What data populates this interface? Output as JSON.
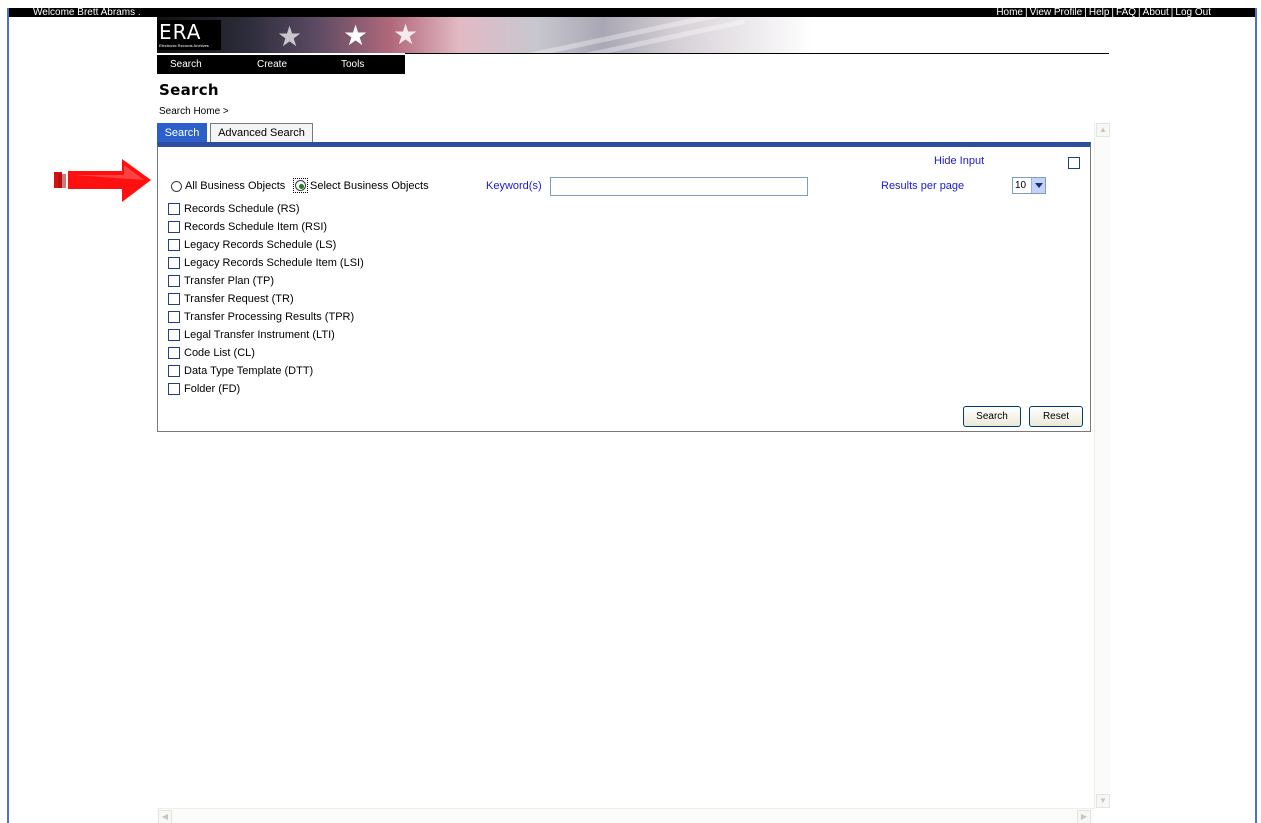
{
  "topbar": {
    "welcome": "Welcome Brett Abrams .",
    "links": [
      "Home",
      "View Profile",
      "Help",
      "FAQ",
      "About",
      "Log Out"
    ],
    "separator": "|"
  },
  "logo": {
    "title": "ERA",
    "subtitle": "Electronic Records Archives"
  },
  "menu": {
    "items": [
      "Search",
      "Create",
      "Tools"
    ]
  },
  "page": {
    "title": "Search",
    "breadcrumb": "Search Home >"
  },
  "tabs": [
    {
      "label": "Search",
      "active": true
    },
    {
      "label": "Advanced Search",
      "active": false
    }
  ],
  "form": {
    "hide_input_label": "Hide Input",
    "scope_options": [
      {
        "label": "All Business Objects",
        "selected": false
      },
      {
        "label": "Select Business Objects",
        "selected": true
      }
    ],
    "keyword_label": "Keyword(s)",
    "keyword_value": "",
    "results_per_page_label": "Results per page",
    "results_per_page_value": "10",
    "object_types": [
      {
        "label": "Records Schedule (RS)",
        "checked": false
      },
      {
        "label": "Records Schedule Item (RSI)",
        "checked": false
      },
      {
        "label": "Legacy Records Schedule (LS)",
        "checked": false
      },
      {
        "label": "Legacy Records Schedule Item (LSI)",
        "checked": false
      },
      {
        "label": "Transfer Plan (TP)",
        "checked": false
      },
      {
        "label": "Transfer Request (TR)",
        "checked": false
      },
      {
        "label": "Transfer Processing Results (TPR)",
        "checked": false
      },
      {
        "label": "Legal Transfer Instrument (LTI)",
        "checked": false
      },
      {
        "label": "Code List (CL)",
        "checked": false
      },
      {
        "label": "Data Type Template (DTT)",
        "checked": false
      },
      {
        "label": "Folder (FD)",
        "checked": false
      }
    ],
    "search_button": "Search",
    "reset_button": "Reset"
  },
  "colors": {
    "accent": "#2d5fcb",
    "panel_border": "#2d4e9e",
    "link": "#1a1ad0",
    "annotation_arrow": "#e01010"
  },
  "icons": {
    "annotation": "red-arrow-right",
    "scroll_up": "scroll-up-icon",
    "scroll_down": "scroll-down-icon",
    "scroll_left": "scroll-left-icon",
    "scroll_right": "scroll-right-icon"
  }
}
